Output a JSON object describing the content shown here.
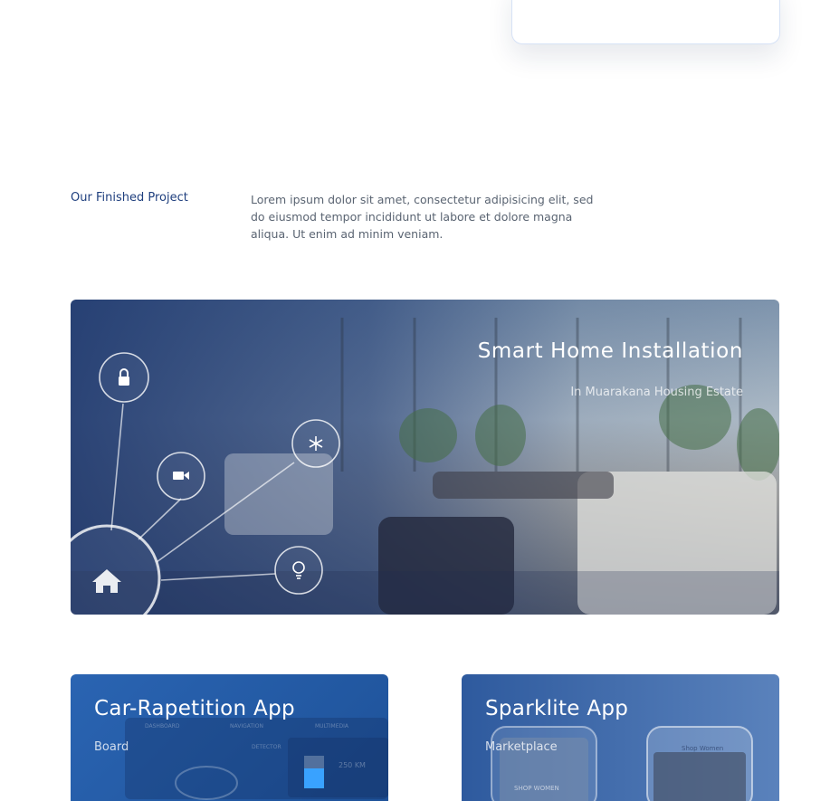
{
  "section": {
    "label": "Our Finished Project",
    "description": "Lorem ipsum dolor sit amet, consectetur adipisicing elit, sed do eiusmod tempor incididunt ut labore et dolore magna aliqua. Ut enim ad minim veniam."
  },
  "hero": {
    "title": "Smart Home Installation",
    "subtitle": "In Muarakana Housing Estate",
    "icons": [
      "home-icon",
      "lock-icon",
      "camera-icon",
      "snowflake-icon",
      "lightbulb-icon"
    ]
  },
  "cards": [
    {
      "title": "Car-Rapetition App",
      "subtitle": "Board",
      "screen_labels": [
        "DASHBOARD",
        "NAVIGATION",
        "MULTIMEDIA",
        "DETECTOR",
        "250 KM"
      ]
    },
    {
      "title": "Sparklite App",
      "subtitle": "Marketplace",
      "screen_labels": [
        "SHOP WOMEN",
        "Shop Women"
      ]
    }
  ],
  "colors": {
    "accent": "#1f3f7e",
    "hero_overlay": "#1e386e",
    "card_left": "#2a64b2",
    "card_right": "#2e5a9e"
  }
}
